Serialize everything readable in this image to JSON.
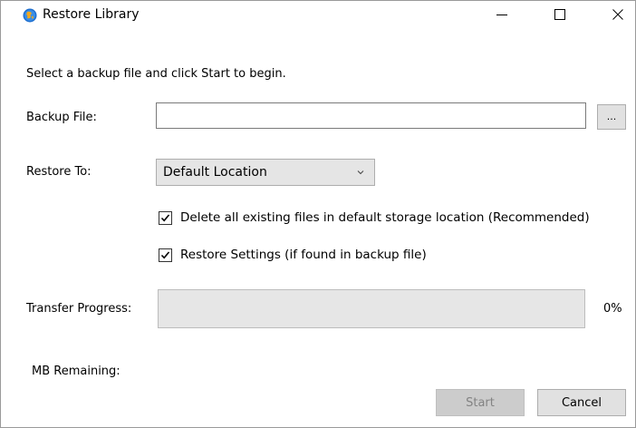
{
  "window": {
    "title": "Restore Library",
    "minimize_glyph": "—",
    "maximize_glyph": "☐",
    "close_glyph": "✕",
    "app_icon": "globe-icon"
  },
  "instructions": "Select a backup file and click Start to begin.",
  "backup_file": {
    "label": "Backup File:",
    "value": "",
    "browse_label": "..."
  },
  "restore_to": {
    "label": "Restore To:",
    "selected": "Default Location"
  },
  "options": {
    "delete_existing": {
      "label": "Delete all existing files in default storage location (Recommended)",
      "checked": true
    },
    "restore_settings": {
      "label": "Restore Settings (if found in backup file)",
      "checked": true
    }
  },
  "transfer": {
    "label": "Transfer Progress:",
    "percent_text": "0%",
    "progress_fraction": 0
  },
  "mb_remaining": {
    "label": "MB Remaining:",
    "value": ""
  },
  "buttons": {
    "start": "Start",
    "cancel": "Cancel"
  },
  "colors": {
    "progress_track": "#e6e6e6",
    "disabled_button_text": "#838383"
  }
}
